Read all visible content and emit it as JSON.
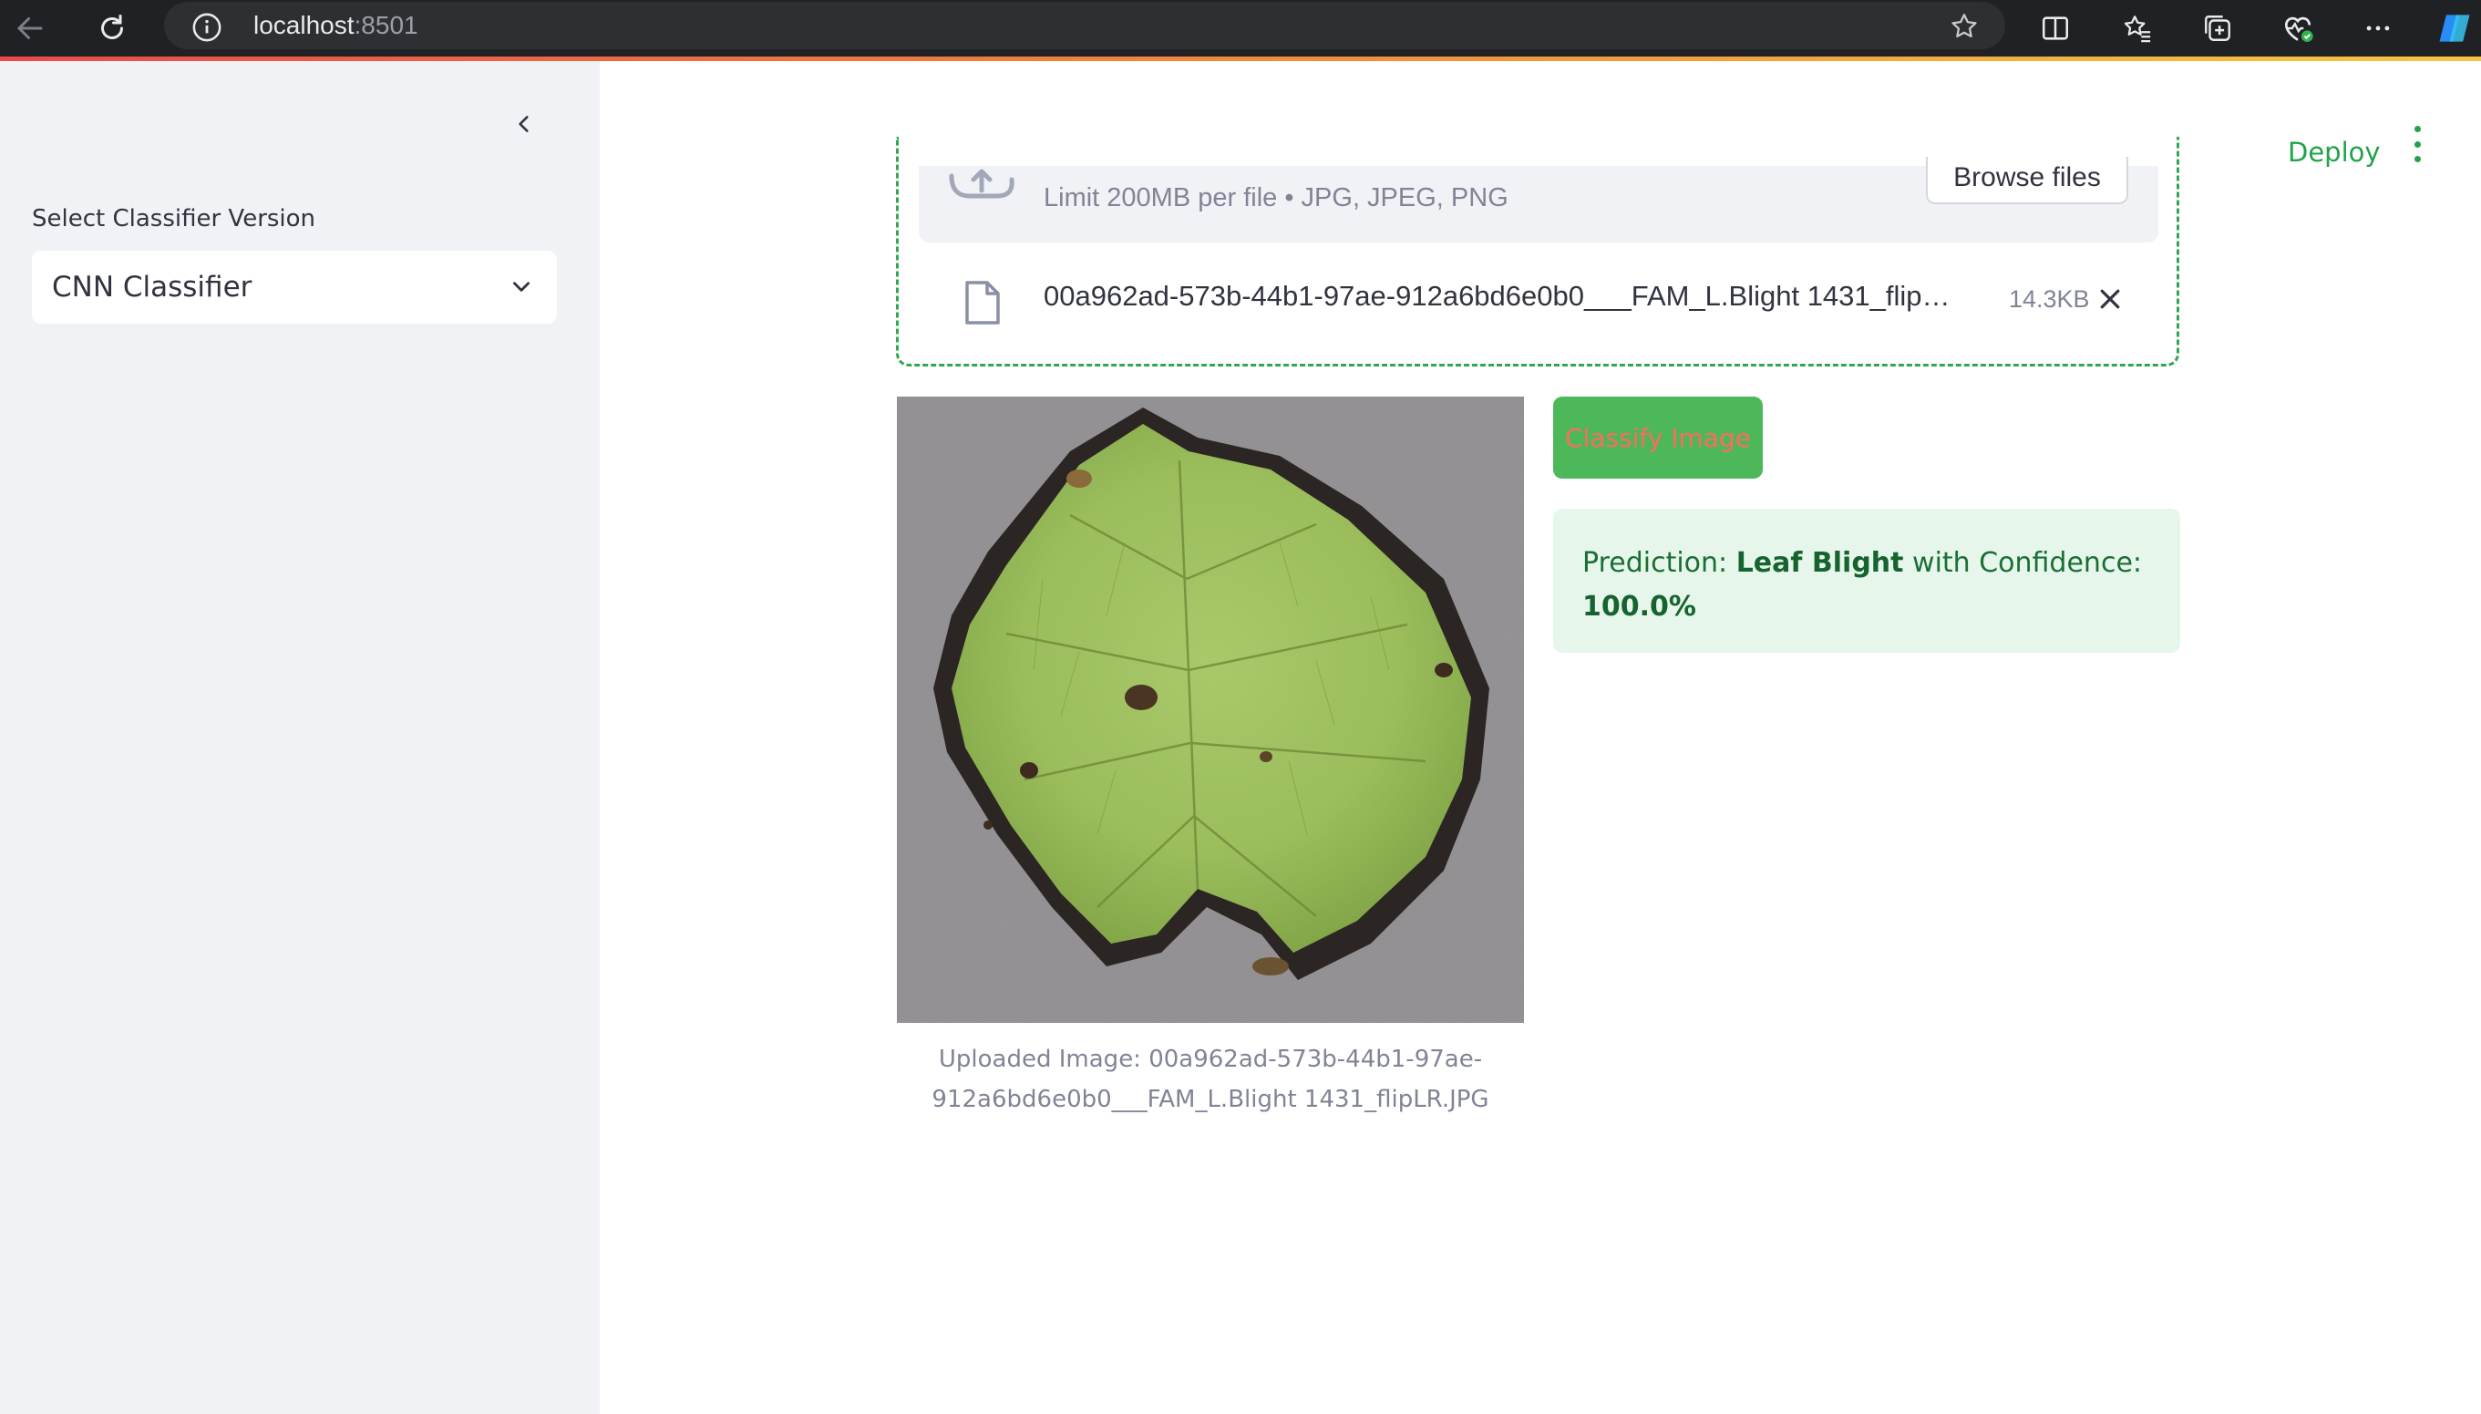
{
  "browser": {
    "url_host": "localhost",
    "url_port": ":8501"
  },
  "sidebar": {
    "select_label": "Select Classifier Version",
    "select_value": "CNN Classifier"
  },
  "header": {
    "deploy_label": "Deploy"
  },
  "uploader": {
    "limit_text": "Limit 200MB per file • JPG, JPEG, PNG",
    "browse_label": "Browse files",
    "file_name": "00a962ad-573b-44b1-97ae-912a6bd6e0b0___FAM_L.Blight 1431_flip…",
    "file_size": "14.3KB"
  },
  "image": {
    "caption_line1": "Uploaded Image: 00a962ad-573b-44b1-97ae-",
    "caption_line2": "912a6bd6e0b0___FAM_L.Blight 1431_flipLR.JPG"
  },
  "actions": {
    "classify_label": "Classify Image"
  },
  "result": {
    "prefix": "Prediction: ",
    "label": "Leaf Blight",
    "middle": " with Confidence:",
    "confidence": "100.0%"
  },
  "colors": {
    "accent_green": "#21a34a",
    "button_green": "#4cb85a",
    "success_bg": "#e6f6ea",
    "sidebar_bg": "#f0f2f6"
  }
}
